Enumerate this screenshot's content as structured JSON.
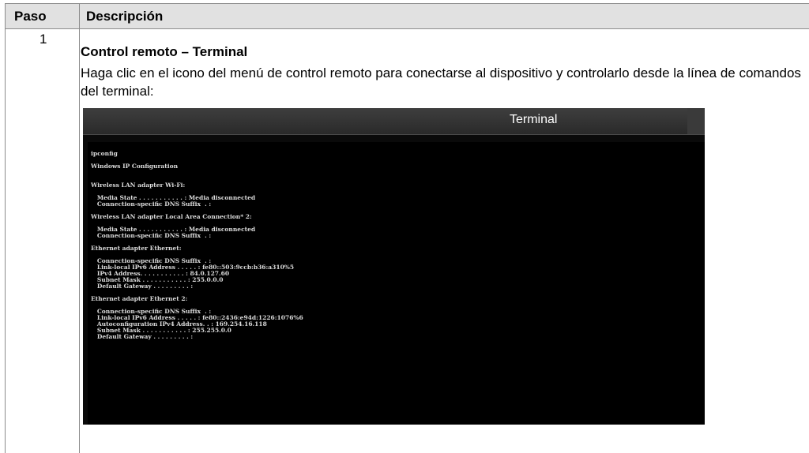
{
  "table": {
    "header_step": "Paso",
    "header_description": "Descripción"
  },
  "step": {
    "number": "1",
    "title": "Control remoto – Terminal",
    "text": "Haga clic en el icono del menú de control remoto para conectarse al dispositivo y controlarlo desde la línea de comandos del terminal:"
  },
  "terminal": {
    "window_title": "Terminal",
    "output": "ipconfig\n\nWindows IP Configuration\n\n\nWireless LAN adapter Wi-Fi:\n\n   Media State . . . . . . . . . . . : Media disconnected\n   Connection-specific DNS Suffix  . :\n\nWireless LAN adapter Local Area Connection* 2:\n\n   Media State . . . . . . . . . . . : Media disconnected\n   Connection-specific DNS Suffix  . :\n\nEthernet adapter Ethernet:\n\n   Connection-specific DNS Suffix  . :\n   Link-local IPv6 Address . . . . . : fe80::503:9ccb:b36:a310%5\n   IPv4 Address. . . . . . . . . . . : 84.0.127.60\n   Subnet Mask . . . . . . . . . . . : 255.0.0.0\n   Default Gateway . . . . . . . . . :\n\nEthernet adapter Ethernet 2:\n\n   Connection-specific DNS Suffix  . :\n   Link-local IPv6 Address . . . . . : fe80::2436:e94d:1226:1076%6\n   Autoconfiguration IPv4 Address. . : 169.254.16.118\n   Subnet Mask . . . . . . . . . . . : 255.255.0.0\n   Default Gateway . . . . . . . . . :"
  }
}
